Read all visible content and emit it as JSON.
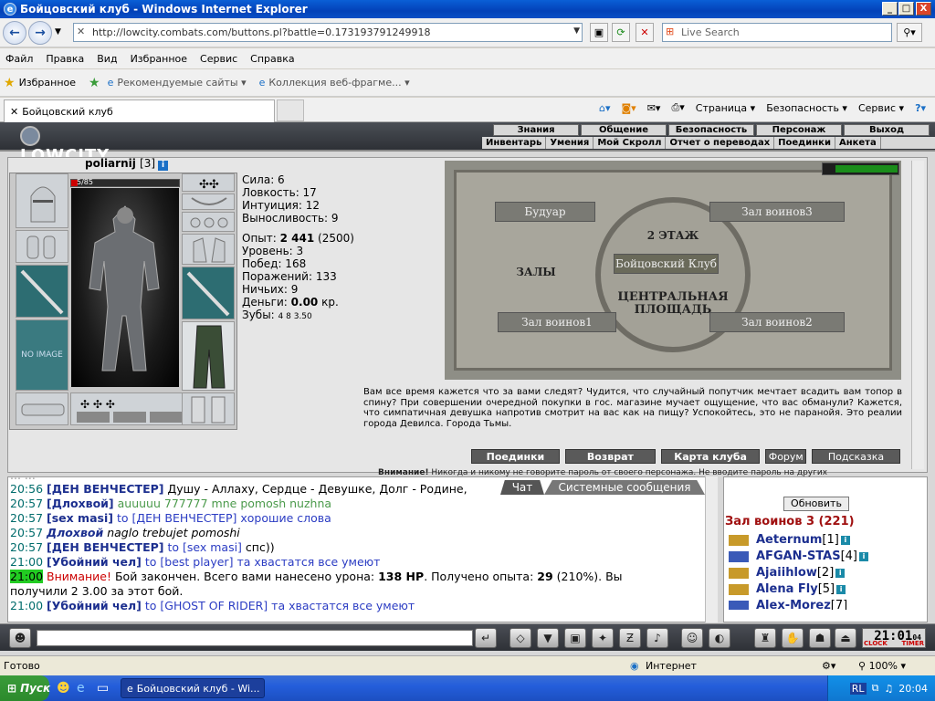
{
  "window": {
    "title": "Бойцовский клуб - Windows Internet Explorer",
    "min": "_",
    "max": "□",
    "close": "X"
  },
  "nav": {
    "url": "http://lowcity.combats.com/buttons.pl?battle=0.173193791249918",
    "search_placeholder": "Live Search",
    "back": "←",
    "forward": "→"
  },
  "menu": [
    "Файл",
    "Правка",
    "Вид",
    "Избранное",
    "Сервис",
    "Справка"
  ],
  "favorites": {
    "label": "Избранное",
    "items": [
      "Рекомендуемые сайты ▾",
      "Коллекция веб-фрагме... ▾"
    ]
  },
  "tab": {
    "label": "Бойцовский клуб"
  },
  "commands": [
    "Страница ▾",
    "Безопасность ▾",
    "Сервис ▾"
  ],
  "game": {
    "logo": "LOWCITY",
    "top_nav": [
      "Знания",
      "Общение",
      "Безопасность",
      "Персонаж",
      "Выход"
    ],
    "sub_nav": [
      "Инвентарь",
      "Умения",
      "Мой Скролл",
      "Отчет о переводах",
      "Поединки",
      "Анкета"
    ],
    "character": {
      "name": "poliarnij",
      "level": "[3]",
      "hp_text": "5/85",
      "hp_fraction": 0.06,
      "no_image": "NO IMAGE"
    },
    "stats": {
      "strength": "Сила: 6",
      "agility": "Ловкость: 17",
      "intuition": "Интуиция: 12",
      "endurance": "Выносливость: 9",
      "exp_label": "Опыт:",
      "exp_value": "2 441",
      "exp_next": "(2500)",
      "level": "Уровень: 3",
      "wins": "Побед: 168",
      "losses": "Поражений: 133",
      "draws": "Ничьих: 9",
      "money_label": "Деньги:",
      "money_value": "0.00",
      "money_unit": "кр.",
      "teeth_label": "Зубы:",
      "teeth_value": "4 8 3.50"
    },
    "map": {
      "boudoir": "Будуар",
      "hall3": "Зал воинов3",
      "floor2": "2 ЭТАЖ",
      "club": "Бойцовский Клуб",
      "halls": "ЗАЛЫ",
      "central": "ЦЕНТРАЛЬНАЯ",
      "square": "ПЛОЩАДЬ",
      "hall1": "Зал воинов1",
      "hall2": "Зал воинов2"
    },
    "flavor_text": "Вам все время кажется что за вами следят? Чудится, что случайный попутчик мечтает всадить вам топор в спину? При совершении очередной покупки в гос. магазине мучает ощущение, что вас обманули? Кажется, что симпатичная девушка напротив смотрит на вас как на пищу? Успокойтесь, это не паранойя. Это реалии города Девилса. Города Тьмы.",
    "actions": [
      "Поединки",
      "Возврат",
      "Карта клуба",
      "Форум",
      "Подсказка"
    ],
    "warning_label": "Внимание!",
    "warning_text": "Никогда и никому не говорите пароль от своего персонажа. Не вводите пароль на других"
  },
  "chat": {
    "tabs": [
      "Чат",
      "Системные сообщения"
    ],
    "partial_top": "... ...",
    "messages": [
      {
        "time": "20:56",
        "name": "[ДЕН ВЕНЧЕСТЕР]",
        "text": "Душу - Аллаху, Сердце - Девушке, Долг - Родине,"
      },
      {
        "time": "20:57",
        "name": "[Длохвой]",
        "text": "auuuuu 777777 mne pomosh nuzhna"
      },
      {
        "time": "20:57",
        "name": "[sex masi]",
        "to": "to [ДЕН ВЕНЧЕСТЕР]",
        "text": "хорошие слова"
      },
      {
        "time": "20:57",
        "name": "Длохвой",
        "text": "naglo trebujet pomoshi"
      },
      {
        "time": "20:57",
        "name": "[ДЕН ВЕНЧЕСТЕР]",
        "to": "to [sex masi]",
        "text": "спс))"
      },
      {
        "time": "21:00",
        "name": "[Убойний чел]",
        "to": "to [best player]",
        "text": "та хвастатся все умеют"
      },
      {
        "time": "21:00",
        "warn": "Внимание!",
        "text": "Бой закончен. Всего вами нанесено урона:",
        "dmg": "138 HP",
        "text2": ". Получено опыта:",
        "exp": "29",
        "text3": "(210%). Вы"
      },
      {
        "text": "получили 2 3.00 за этот бой."
      },
      {
        "time": "21:00",
        "name": "[Убойний чел]",
        "to": "to [GHOST OF RIDER]",
        "text": "та хвастатся все умеют"
      }
    ]
  },
  "side": {
    "refresh": "Обновить",
    "room": "Зал воинов 3 (221)",
    "users": [
      {
        "name": "Aeternum",
        "lvl": "[1]"
      },
      {
        "name": "AFGAN-STAS",
        "lvl": "[4]"
      },
      {
        "name": "Ajaiihlow",
        "lvl": "[2]"
      },
      {
        "name": "Alena Fly",
        "lvl": "[5]"
      },
      {
        "name": "Alex-Morez",
        "lvl": "[7]"
      }
    ]
  },
  "clock": {
    "time": "21:01",
    "seconds": "04",
    "label_clock": "CLOCK",
    "label_timer": "TIMER"
  },
  "status": {
    "text": "Готово",
    "zone": "Интернет",
    "zoom": "100%"
  },
  "taskbar": {
    "start": "Пуск",
    "task": "Бойцовский клуб - Wi...",
    "lang": "RL",
    "time": "20:04"
  },
  "colors": {
    "title_blue": "#0a4fc5",
    "chat_time": "#006c6c",
    "chat_name": "#1c2f8f",
    "room_red": "#a01010",
    "highlight_green": "#22cc22"
  }
}
